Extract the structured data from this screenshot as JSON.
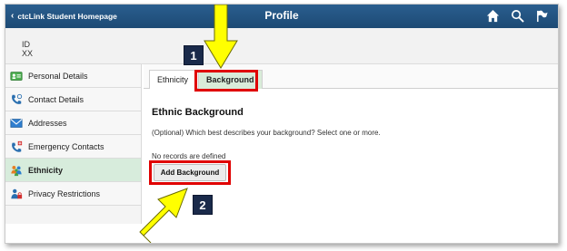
{
  "header": {
    "home_link": "ctcLink Student Homepage",
    "title": "Profile",
    "icons": [
      "home-icon",
      "search-icon",
      "flag-icon"
    ],
    "bar_color": "#1f4e79"
  },
  "id_bar": {
    "label": "ID",
    "value": "XX"
  },
  "sidebar": {
    "items": [
      {
        "label": "Personal Details",
        "icon": "id-card-icon"
      },
      {
        "label": "Contact Details",
        "icon": "phone-icon"
      },
      {
        "label": "Addresses",
        "icon": "envelope-icon"
      },
      {
        "label": "Emergency Contacts",
        "icon": "emergency-phone-icon"
      },
      {
        "label": "Ethnicity",
        "icon": "people-icon",
        "active": true
      },
      {
        "label": "Privacy Restrictions",
        "icon": "person-lock-icon"
      }
    ],
    "active_color": "#d7ecdc"
  },
  "tabs": [
    {
      "label": "Ethnicity"
    },
    {
      "label": "Background",
      "active": true
    }
  ],
  "content": {
    "title": "Ethnic Background",
    "description": "(Optional) Which best describes your background? Select one or more.",
    "no_records": "No records are defined",
    "add_button": "Add Background"
  },
  "callouts": {
    "step1": "1",
    "step2": "2",
    "highlight_color": "#e00000",
    "arrow_color": "#ffff00"
  }
}
